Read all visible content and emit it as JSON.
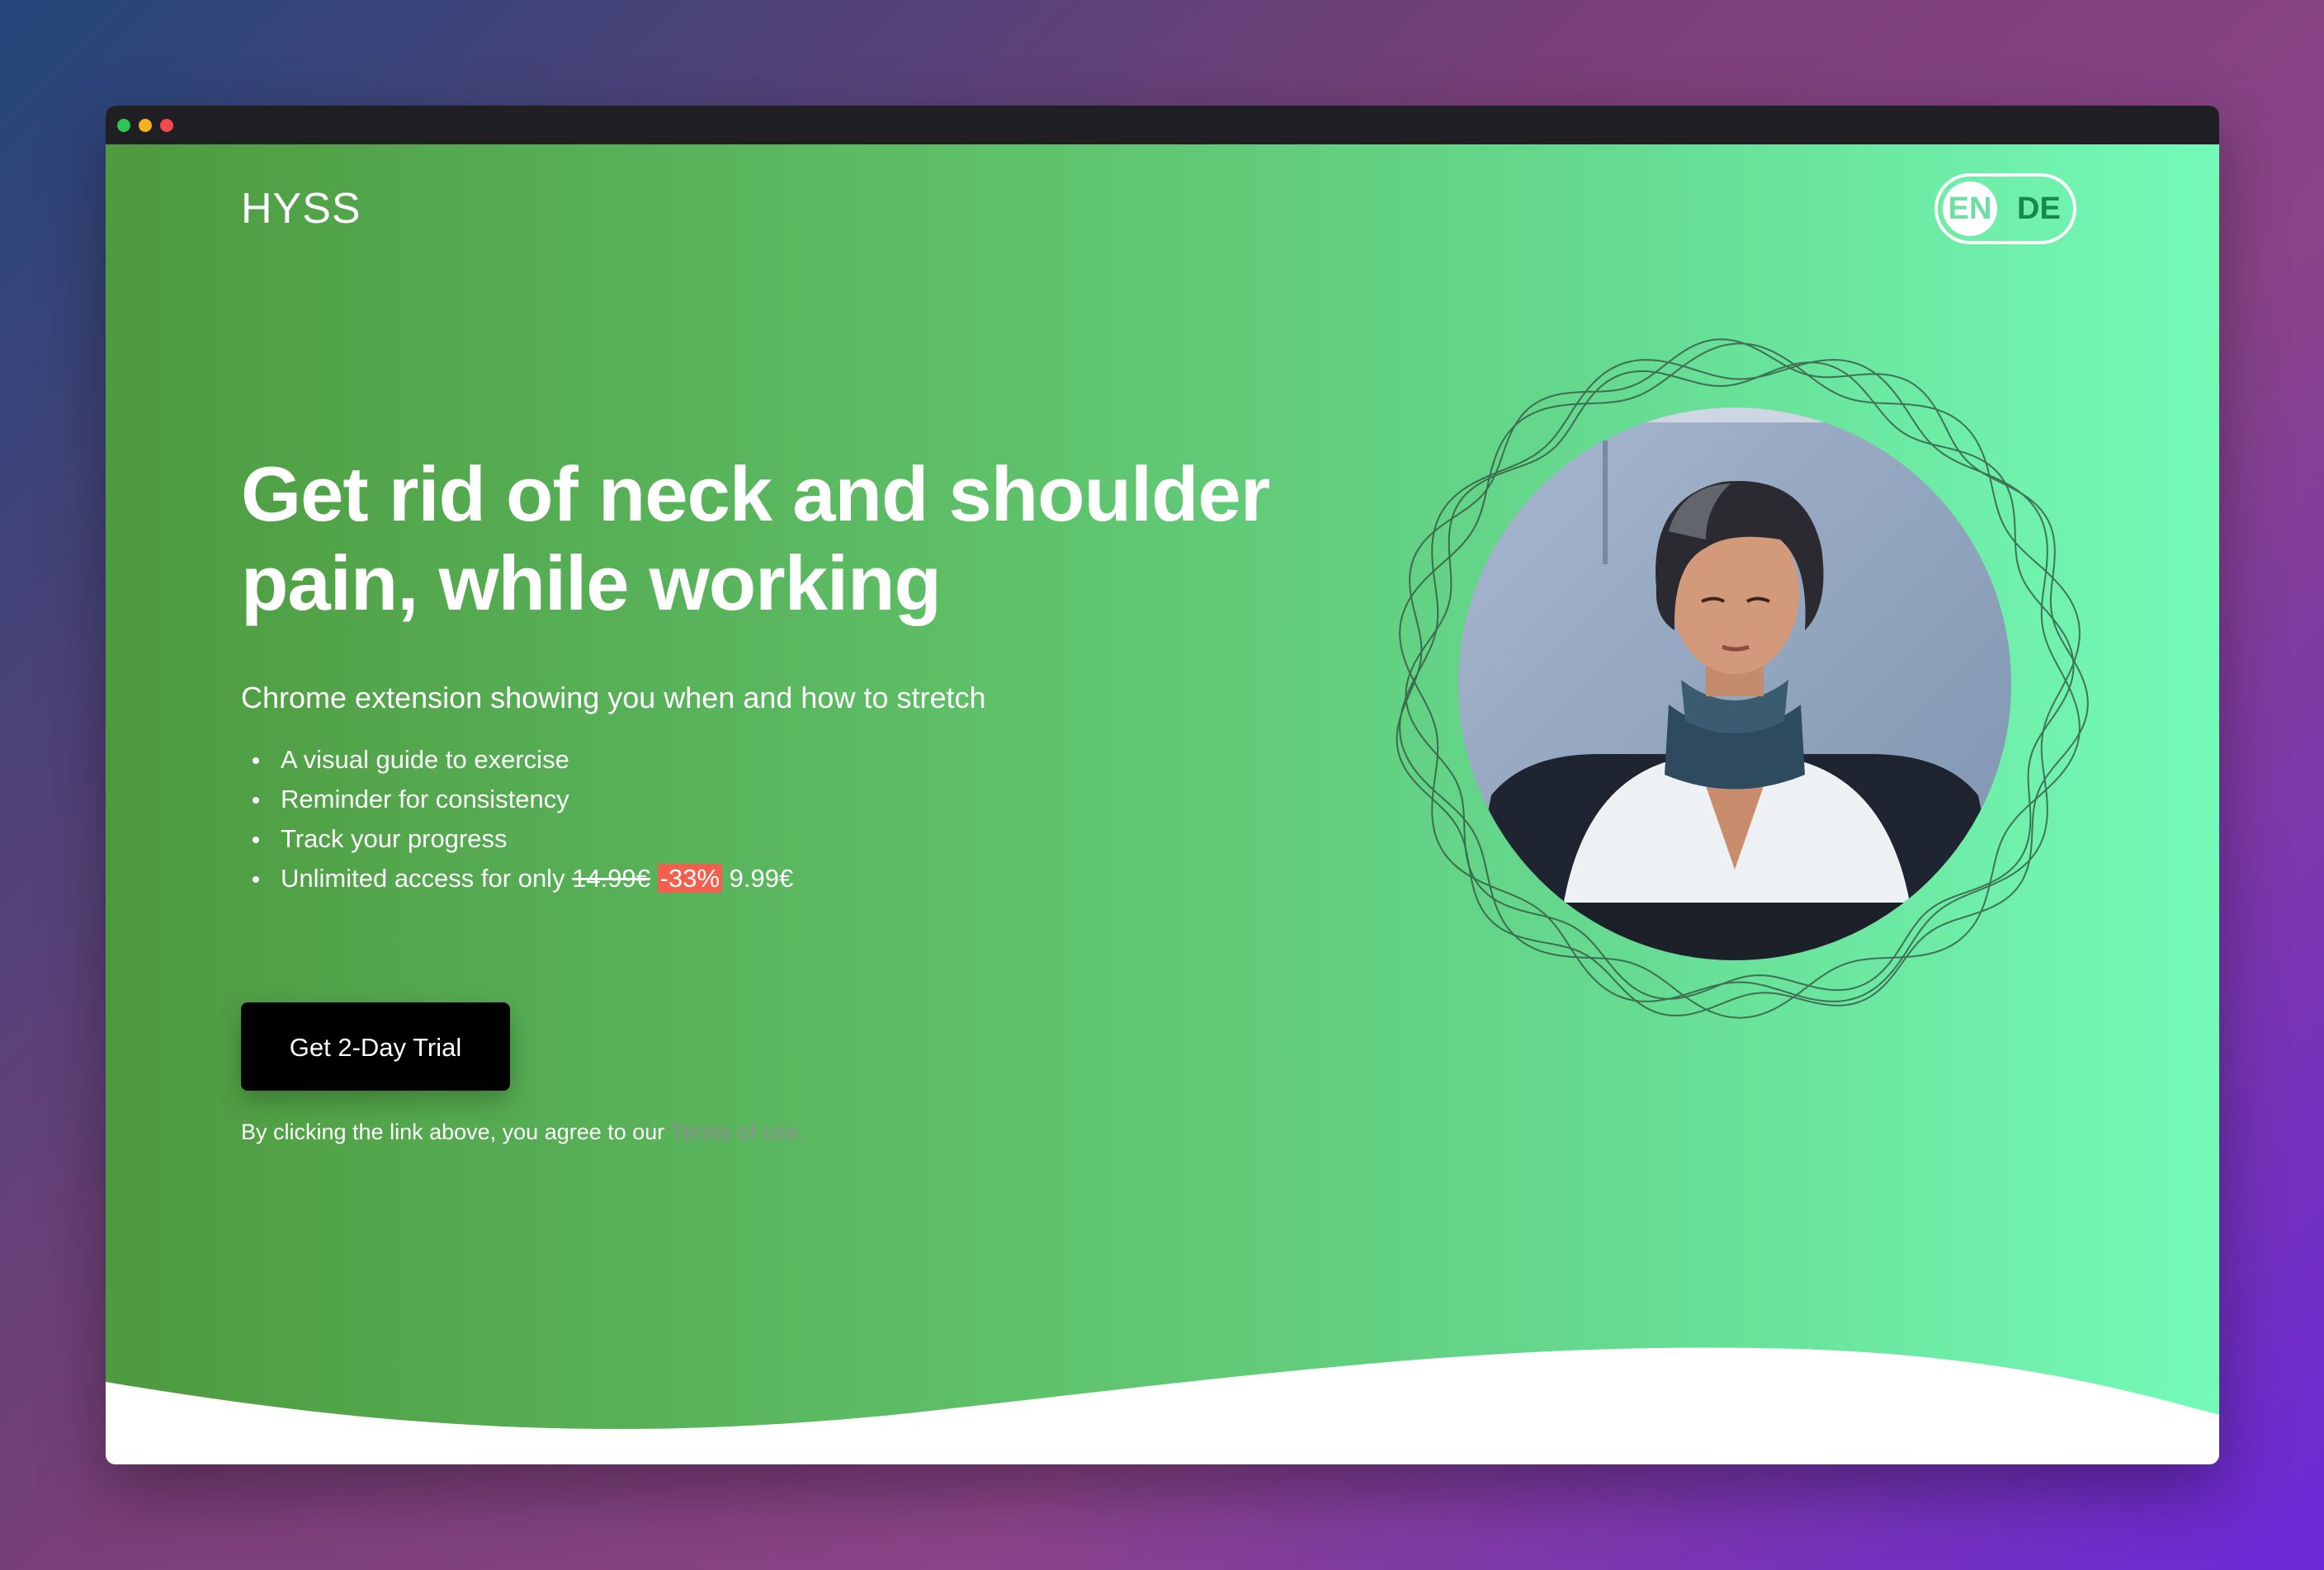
{
  "window": {
    "controls": [
      "close",
      "minimize",
      "maximize"
    ]
  },
  "header": {
    "logo": "HYSS",
    "language": {
      "active": "EN",
      "inactive": "DE"
    }
  },
  "hero": {
    "headline": "Get rid of neck and shoulder pain, while working",
    "subtitle": "Chrome extension showing you when and how to stretch",
    "features": [
      "A visual guide to exercise",
      "Reminder for consistency",
      "Track your progress"
    ],
    "pricing": {
      "prefix": "Unlimited access for only",
      "old_price": "14.99€",
      "discount": "-33%",
      "new_price": "9.99€"
    },
    "cta_label": "Get 2-Day Trial",
    "legal_text": "By clicking the link above, you agree to our",
    "terms_link": "Terms of use."
  },
  "colors": {
    "gradient_start": "#4e9a3e",
    "gradient_end": "#74fbb8",
    "cta_background": "#000000",
    "discount_badge": "#f25f4c"
  },
  "icons": [
    "window-close-dot",
    "window-minimize-dot",
    "window-maximize-dot",
    "decorative-rings"
  ]
}
